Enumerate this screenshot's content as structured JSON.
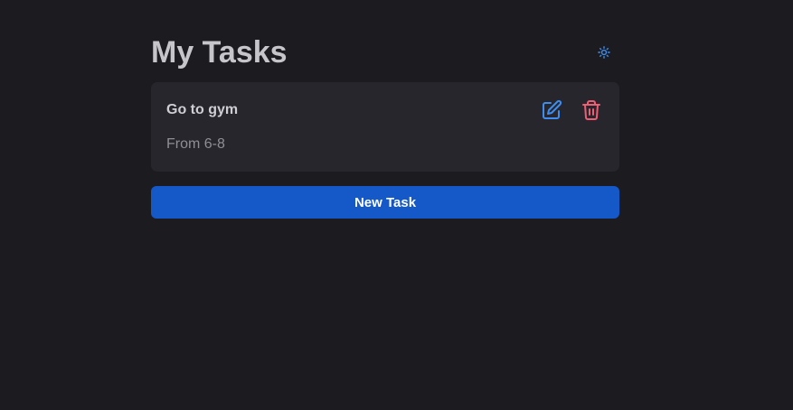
{
  "header": {
    "title": "My Tasks",
    "theme_toggle_icon": "sun-icon"
  },
  "tasks": [
    {
      "title": "Go to gym",
      "description": "From 6-8",
      "edit_icon": "edit-icon",
      "delete_icon": "trash-icon"
    }
  ],
  "actions": {
    "new_task_label": "New Task"
  },
  "colors": {
    "background": "#1c1b20",
    "card": "#27262c",
    "primary": "#1558c7",
    "edit": "#3d8ef0",
    "delete": "#ee5f75",
    "theme_icon": "#3d8ef0"
  }
}
